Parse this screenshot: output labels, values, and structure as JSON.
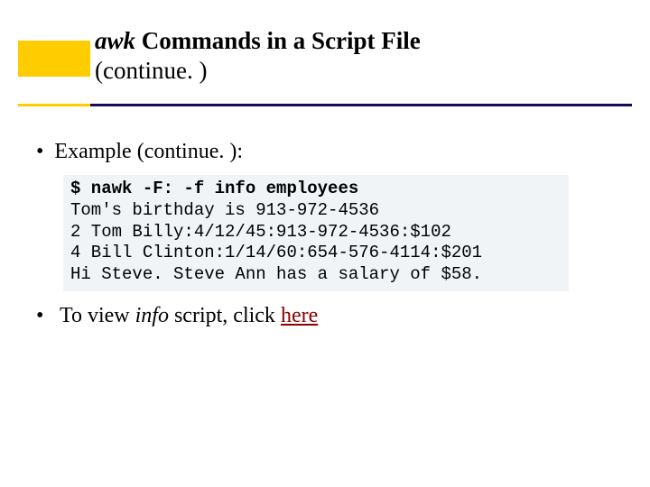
{
  "header": {
    "title_awk": "awk",
    "title_rest": " Commands in a Script File",
    "subtitle": "(continue. )"
  },
  "bullets": {
    "example": "Example (continue. ):",
    "view_prefix": "To view ",
    "view_info": "info",
    "view_mid": " script, click ",
    "view_link": "here"
  },
  "code": {
    "cmd": "$ nawk -F: -f info employees",
    "l1": "Tom's birthday is 913-972-4536",
    "l2": "2 Tom Billy:4/12/45:913-972-4536:$102",
    "l3": "4 Bill Clinton:1/14/60:654-576-4114:$201",
    "l4": "Hi Steve. Steve Ann has a salary of $58."
  }
}
